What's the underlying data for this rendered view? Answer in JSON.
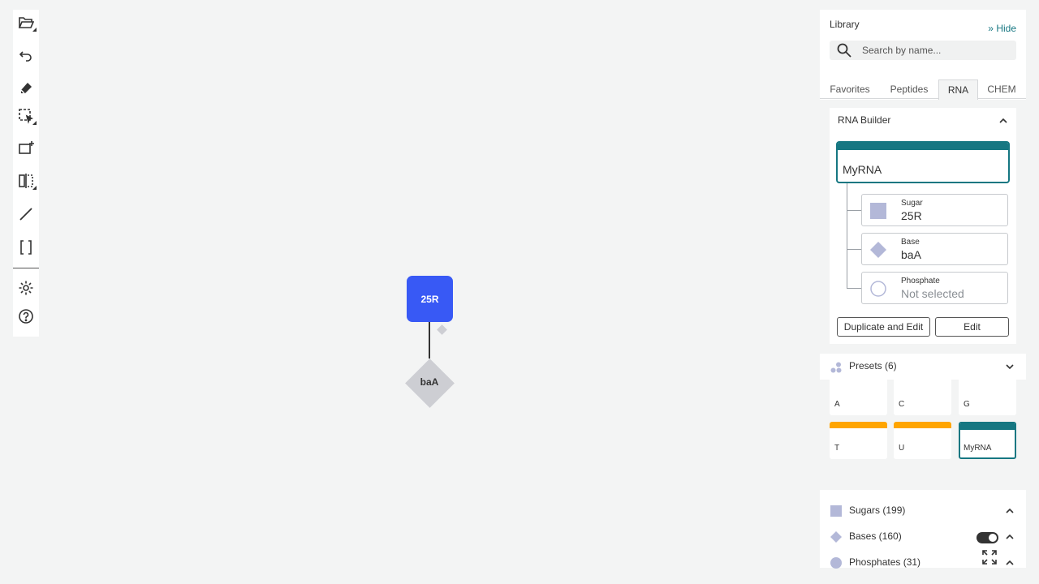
{
  "toolbar": {
    "tools": [
      {
        "name": "open-file-icon"
      },
      {
        "name": "undo-icon"
      },
      {
        "name": "eraser-icon"
      },
      {
        "name": "select-icon"
      },
      {
        "name": "add-sequence-icon"
      },
      {
        "name": "mirror-icon"
      },
      {
        "name": "bond-icon"
      },
      {
        "name": "brackets-icon"
      },
      {
        "name": "settings-icon"
      },
      {
        "name": "help-icon"
      }
    ]
  },
  "canvas": {
    "sugar_label": "25R",
    "base_label": "baA",
    "sugar_color": "#3859f5",
    "base_color": "#cdced3"
  },
  "library": {
    "title": "Library",
    "hide_label": "Hide",
    "search_placeholder": "Search by name...",
    "tabs": [
      "Favorites",
      "Peptides",
      "RNA",
      "CHEM"
    ],
    "active_tab": "RNA",
    "accent": "#167782"
  },
  "builder": {
    "title": "RNA Builder",
    "name_value": "MyRNA",
    "components": [
      {
        "label": "Sugar",
        "value": "25R",
        "icon": "sugar-square-icon"
      },
      {
        "label": "Base",
        "value": "baA",
        "icon": "base-diamond-icon"
      },
      {
        "label": "Phosphate",
        "value": "Not selected",
        "icon": "phosphate-circle-icon"
      }
    ],
    "duplicate_label": "Duplicate and Edit",
    "edit_label": "Edit"
  },
  "presets": {
    "title": "Presets (6)",
    "items": [
      {
        "name": "A",
        "color": "#ffffff"
      },
      {
        "name": "C",
        "color": "#ffffff"
      },
      {
        "name": "G",
        "color": "#ffffff"
      },
      {
        "name": "T",
        "color": "#ffa500"
      },
      {
        "name": "U",
        "color": "#ffa500"
      },
      {
        "name": "MyRNA",
        "color": "#167782"
      }
    ]
  },
  "groups": [
    {
      "label": "Sugars (199)"
    },
    {
      "label": "Bases (160)"
    },
    {
      "label": "Phosphates (31)"
    }
  ]
}
